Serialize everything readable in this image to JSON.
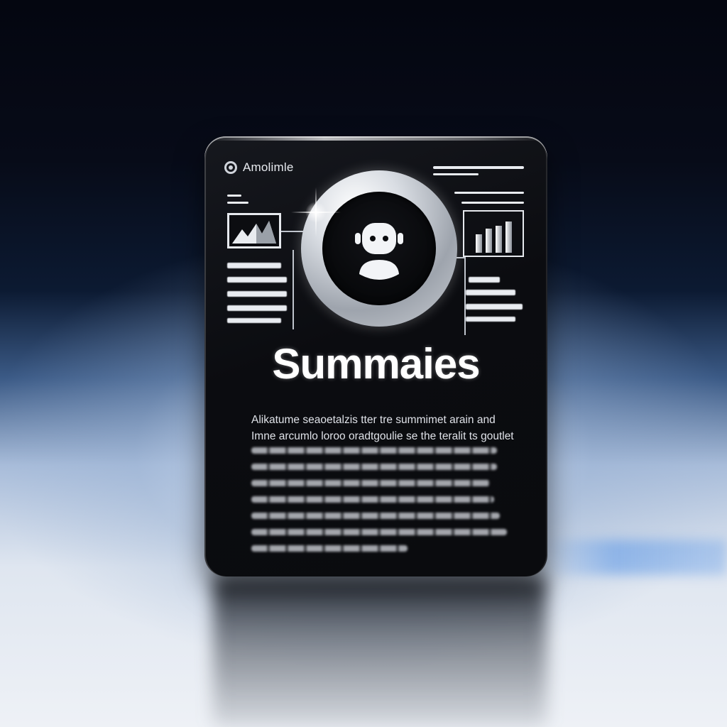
{
  "brand": {
    "name": "Amolimle",
    "icon": "target-circle-icon"
  },
  "hero": {
    "icon": "robot-avatar-icon",
    "sparkle": "sparkle-icon"
  },
  "widgets": {
    "left_image": "mountain-image-icon",
    "right_chart": "bar-chart-icon"
  },
  "title": "Summaies",
  "paragraph": {
    "line1": "Alikatume seaoetalzis tter tre summimet arain and",
    "line2": "Imne arcumlo loroo oradtgoulie se the teralit ts goutlet"
  },
  "colors": {
    "card": "#0b0c10",
    "text": "#ffffff",
    "accent_glow": "#5a96e6"
  }
}
